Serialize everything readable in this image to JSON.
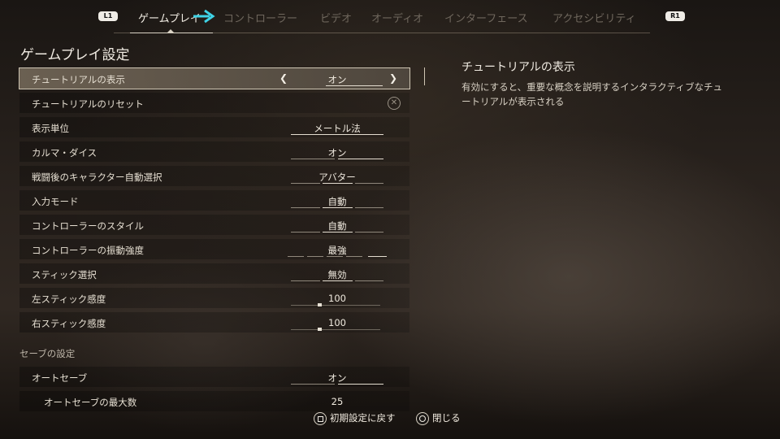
{
  "header": {
    "left_button": "L1",
    "right_button": "R1",
    "tabs": [
      {
        "label": "ゲームプレイ",
        "active": true
      },
      {
        "label": "コントローラー",
        "active": false
      },
      {
        "label": "ビデオ",
        "active": false
      },
      {
        "label": "オーディオ",
        "active": false
      },
      {
        "label": "インターフェース",
        "active": false
      },
      {
        "label": "アクセシビリティ",
        "active": false
      }
    ]
  },
  "main": {
    "title": "ゲームプレイ設定",
    "rows": [
      {
        "label": "チュートリアルの表示",
        "value": "オン"
      },
      {
        "label": "チュートリアルのリセット",
        "value": ""
      },
      {
        "label": "表示単位",
        "value": "メートル法"
      },
      {
        "label": "カルマ・ダイス",
        "value": "オン"
      },
      {
        "label": "戦闘後のキャラクター自動選択",
        "value": "アバター"
      },
      {
        "label": "入力モード",
        "value": "自動"
      },
      {
        "label": "コントローラーのスタイル",
        "value": "自動"
      },
      {
        "label": "コントローラーの振動強度",
        "value": "最強"
      },
      {
        "label": "スティック選択",
        "value": "無効"
      },
      {
        "label": "左スティック感度",
        "value": "100"
      },
      {
        "label": "右スティック感度",
        "value": "100"
      }
    ],
    "save_section": {
      "title": "セーブの設定",
      "rows": [
        {
          "label": "オートセーブ",
          "value": "オン"
        },
        {
          "label": "オートセーブの最大数",
          "value": "25"
        }
      ]
    }
  },
  "description": {
    "title": "チュートリアルの表示",
    "text": "有効にすると、重要な概念を説明するインタラクティブなチュートリアルが表示される"
  },
  "footer": {
    "reset_label": "初期設定に戻す",
    "close_label": "閉じる"
  },
  "icons": {
    "reset": "close-circle-icon",
    "prev": "chevron-left-icon",
    "next": "chevron-right-icon",
    "cursor": "arrow-right-icon"
  },
  "colors": {
    "cursor_arrow": "#3fd3e6",
    "selected_row": "#786c5c"
  }
}
